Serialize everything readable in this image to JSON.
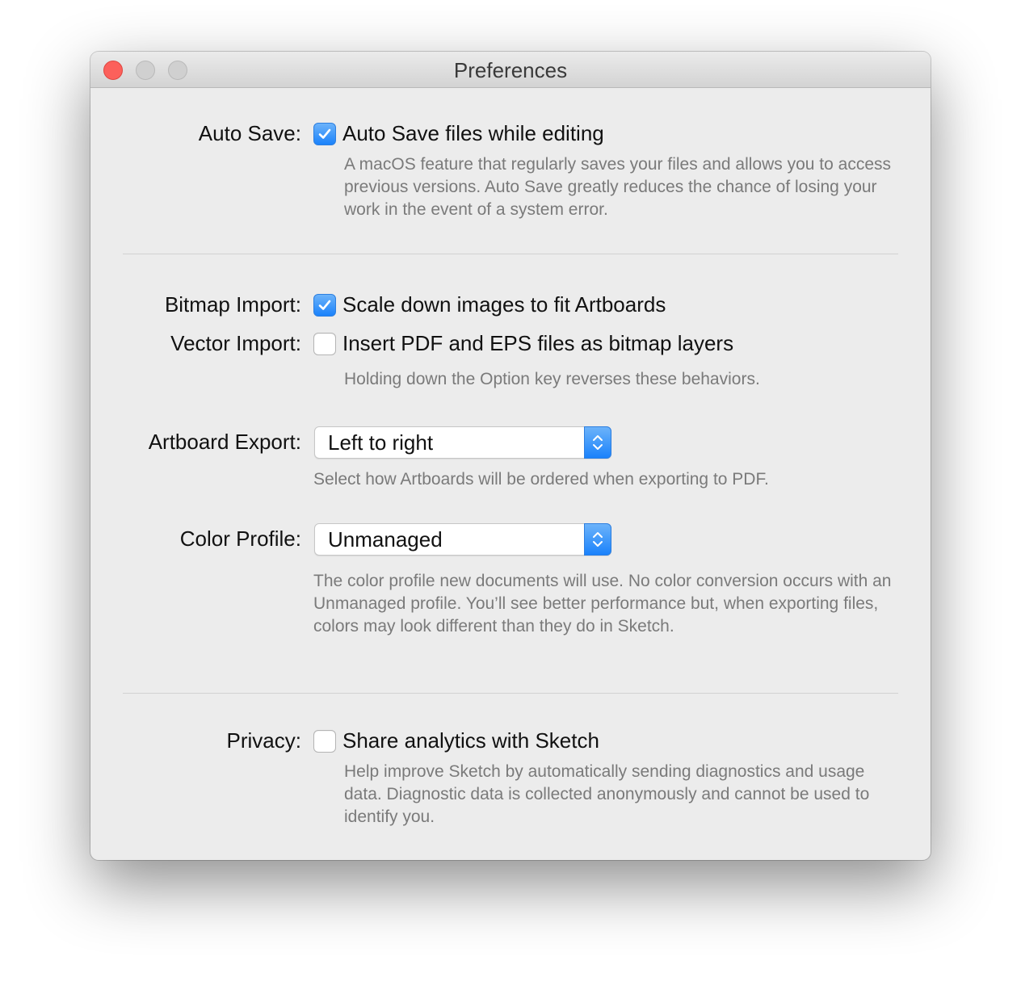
{
  "window": {
    "title": "Preferences"
  },
  "auto_save": {
    "label": "Auto Save:",
    "checkbox_label": "Auto Save files while editing",
    "checked": true,
    "help": "A macOS feature that regularly saves your files and allows you to access previous versions. Auto Save greatly reduces the chance of losing your work in the event of a system error."
  },
  "bitmap_import": {
    "label": "Bitmap Import:",
    "checkbox_label": "Scale down images to fit Artboards",
    "checked": true
  },
  "vector_import": {
    "label": "Vector Import:",
    "checkbox_label": "Insert PDF and EPS files as bitmap layers",
    "checked": false,
    "help": "Holding down the Option key reverses these behaviors."
  },
  "artboard_export": {
    "label": "Artboard Export:",
    "value": "Left to right",
    "help": "Select how Artboards will be ordered when exporting to PDF."
  },
  "color_profile": {
    "label": "Color Profile:",
    "value": "Unmanaged",
    "help": "The color profile new documents will use. No color conversion occurs with an Unmanaged profile. You’ll see better performance but, when exporting files, colors may look different than they do in Sketch."
  },
  "privacy": {
    "label": "Privacy:",
    "checkbox_label": "Share analytics with Sketch",
    "checked": false,
    "help": "Help improve Sketch by automatically sending diagnostics and usage data. Diagnostic data is collected anonymously and cannot be used to identify you."
  },
  "colors": {
    "accent": "#1a82fb",
    "close_button": "#fc605b",
    "window_background": "#ececec"
  },
  "icons": {
    "checkmark": "checkmark-icon",
    "popup_arrows": "updown-chevron-icon"
  }
}
